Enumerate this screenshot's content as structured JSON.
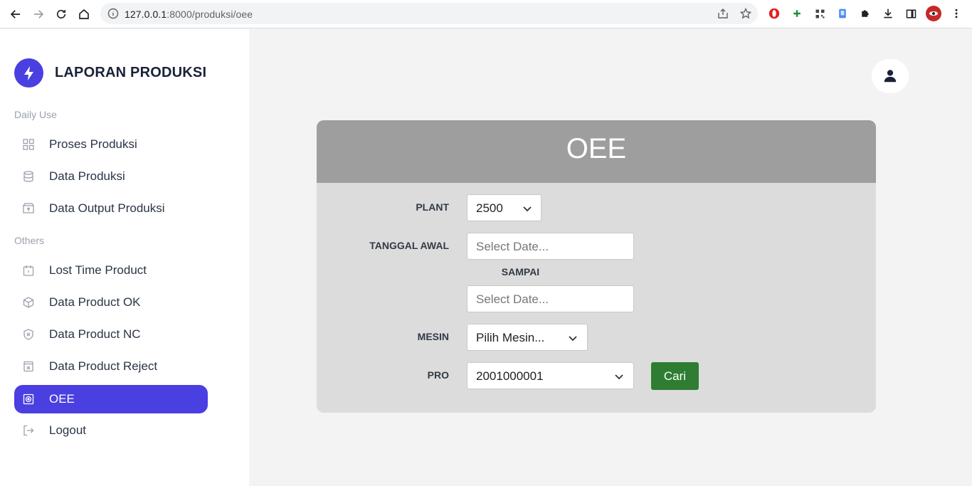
{
  "browser": {
    "url_host": "127.0.0.1",
    "url_path": ":8000/produksi/oee"
  },
  "sidebar": {
    "brand": "LAPORAN PRODUKSI",
    "sections": [
      {
        "label": "Daily Use"
      },
      {
        "label": "Others"
      }
    ],
    "items": [
      {
        "label": "Proses Produksi",
        "icon": "grid-icon"
      },
      {
        "label": "Data Produksi",
        "icon": "database-icon"
      },
      {
        "label": "Data Output Produksi",
        "icon": "archive-icon"
      },
      {
        "label": "Lost Time Product",
        "icon": "calendar-icon"
      },
      {
        "label": "Data Product OK",
        "icon": "box-icon"
      },
      {
        "label": "Data Product NC",
        "icon": "shield-x-icon"
      },
      {
        "label": "Data Product Reject",
        "icon": "file-x-icon"
      },
      {
        "label": "OEE",
        "icon": "target-icon",
        "active": true
      },
      {
        "label": "Logout",
        "icon": "logout-icon"
      }
    ]
  },
  "card": {
    "title": "OEE",
    "plant": {
      "label": "PLANT",
      "value": "2500"
    },
    "tanggal_awal": {
      "label": "TANGGAL AWAL",
      "placeholder": "Select Date..."
    },
    "sampai": {
      "label": "SAMPAI",
      "placeholder": "Select Date..."
    },
    "mesin": {
      "label": "MESIN",
      "value": "Pilih Mesin..."
    },
    "pro": {
      "label": "PRO",
      "value": "2001000001"
    },
    "search_button": "Cari"
  },
  "colors": {
    "accent": "#4a3fe0",
    "header_bg": "#9e9e9e",
    "card_bg": "#dcdcdc",
    "button_green": "#2e7d32"
  }
}
